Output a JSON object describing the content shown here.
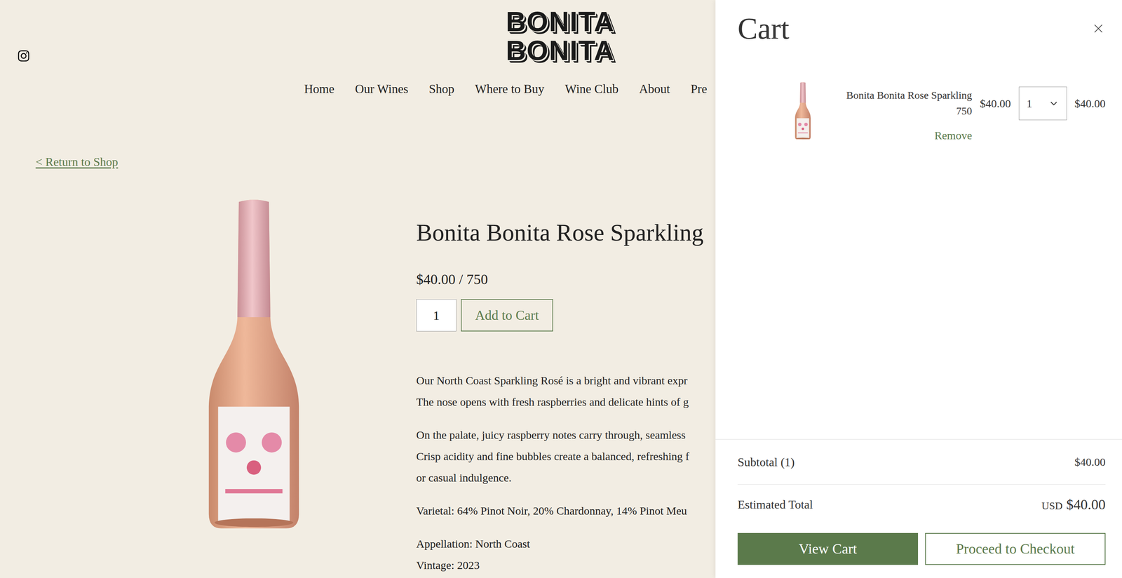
{
  "header": {
    "logo": [
      "BONITA",
      "BONITA"
    ],
    "nav": [
      "Home",
      "Our Wines",
      "Shop",
      "Where to Buy",
      "Wine Club",
      "About",
      "Pre"
    ]
  },
  "back_link": "< Return to Shop",
  "product": {
    "title": "Bonita Bonita Rose Sparkling",
    "price": "$40.00 / 750",
    "quantity": "1",
    "add_button": "Add to Cart",
    "description": [
      [
        "Our North Coast Sparkling Rosé is a bright and vibrant expr",
        "The nose opens with fresh raspberries and delicate hints of g"
      ],
      [
        "On the palate, juicy raspberry notes carry through, seamless",
        "Crisp acidity and fine bubbles create a balanced, refreshing f",
        "or casual indulgence."
      ]
    ],
    "specs": [
      [
        "Varietal: 64% Pinot Noir, 20% Chardonnay, 14% Pinot Meu"
      ],
      [
        "Appellation: North Coast",
        "Vintage: 2023"
      ]
    ]
  },
  "cart": {
    "title": "Cart",
    "items": [
      {
        "name": "Bonita Bonita Rose Sparkling",
        "size": "750",
        "price": "$40.00",
        "quantity": "1",
        "total": "$40.00",
        "remove": "Remove"
      }
    ],
    "subtotal": {
      "label": "Subtotal (1)",
      "value": "$40.00"
    },
    "estimated_total": {
      "label": "Estimated Total",
      "currency": "USD",
      "value": "$40.00"
    },
    "buttons": [
      {
        "label": "View Cart",
        "kind": "filled"
      },
      {
        "label": "Proceed to Checkout",
        "kind": "outline"
      }
    ]
  }
}
